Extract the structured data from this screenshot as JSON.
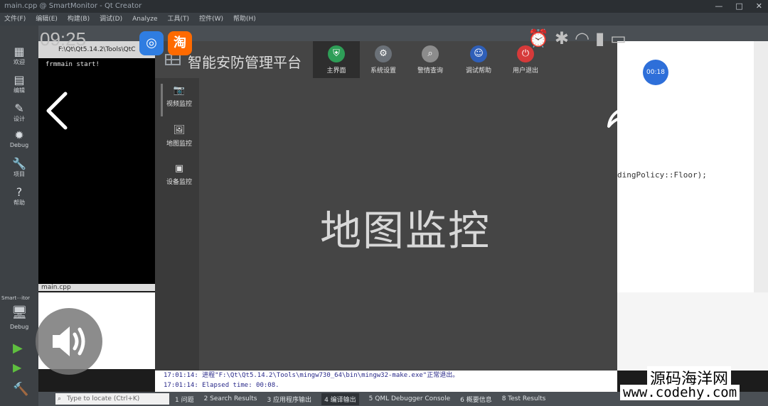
{
  "ide": {
    "title": "main.cpp @ SmartMonitor - Qt Creator",
    "menu": [
      "文件(F)",
      "编辑(E)",
      "构建(B)",
      "调试(D)",
      "Analyze",
      "工具(T)",
      "控件(W)",
      "帮助(H)"
    ],
    "modes": [
      {
        "label": "欢迎",
        "icon": "grid-icon"
      },
      {
        "label": "编辑",
        "icon": "edit-icon"
      },
      {
        "label": "设计",
        "icon": "pencil-icon"
      },
      {
        "label": "Debug",
        "icon": "bug-icon"
      },
      {
        "label": "项目",
        "icon": "wrench-icon"
      },
      {
        "label": "帮助",
        "icon": "help-icon"
      }
    ],
    "kit": {
      "project": "Smart⋯itor",
      "config": "Debug"
    },
    "terminal_title": "F:\\Qt\\Qt5.14.2\\Tools\\QtC",
    "terminal_text": "frmmain start!",
    "file_label": "main.cpp",
    "code_line": "dingPolicy::Floor);",
    "compile_lines": [
      "17:01:14: 进程\"F:\\Qt\\Qt5.14.2\\Tools\\mingw730_64\\bin\\mingw32-make.exe\"正常退出。",
      "17:01:14: Elapsed time: 00:08."
    ],
    "locate_placeholder": "Type to locate (Ctrl+K)",
    "output_tabs": [
      "1 问题",
      "2 Search Results",
      "3 应用程序输出",
      "4 编译输出",
      "5 QML Debugger Console",
      "6 概要信息",
      "8 Test Results"
    ]
  },
  "app": {
    "title": "智能安防管理平台",
    "nav": [
      {
        "label": "主界面",
        "icon": "shield-icon",
        "color": "#2e9e57"
      },
      {
        "label": "系统设置",
        "icon": "gear-icon",
        "color": "#6b7178"
      },
      {
        "label": "警情查询",
        "icon": "search-icon",
        "color": "#8c8c8c"
      },
      {
        "label": "调试帮助",
        "icon": "accessibility-icon",
        "color": "#2f5fb8"
      },
      {
        "label": "用户退出",
        "icon": "power-icon",
        "color": "#d63a3a"
      }
    ],
    "side": [
      {
        "label": "视频监控",
        "icon": "camera-icon"
      },
      {
        "label": "地图监控",
        "icon": "image-icon"
      },
      {
        "label": "设备监控",
        "icon": "device-icon"
      }
    ],
    "content_text": "地图监控"
  },
  "overlay": {
    "clock": "09:25",
    "timer": "00:18",
    "app2_glyph": "淘",
    "watermark_cn": "源码海洋网",
    "watermark_url": "www.codehy.com"
  }
}
